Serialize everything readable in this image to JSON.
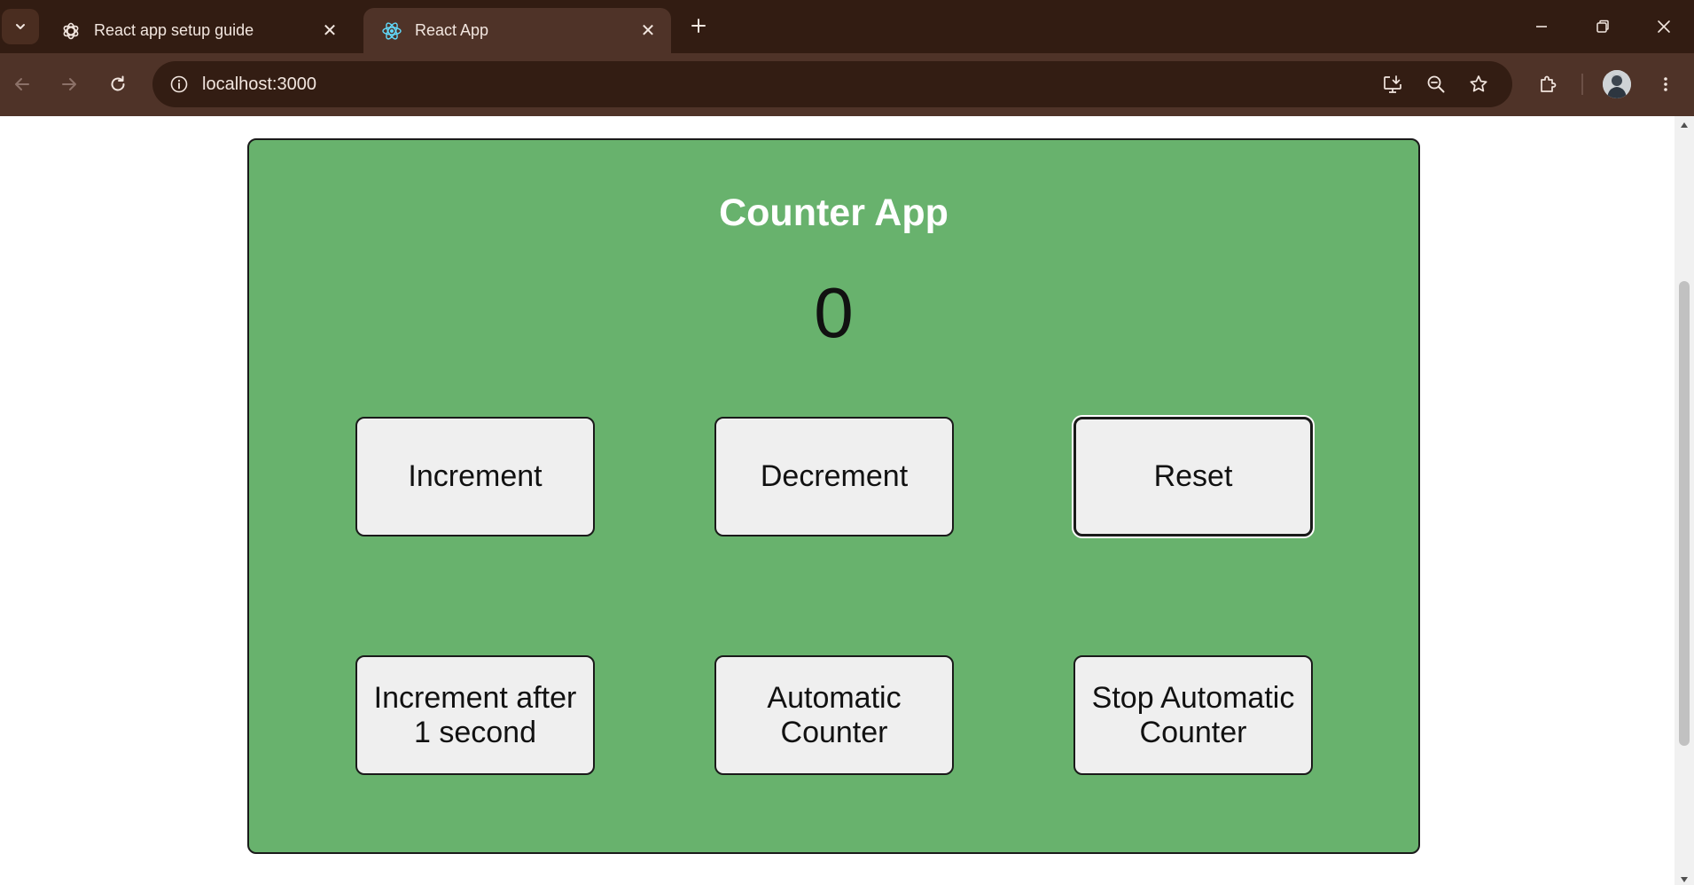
{
  "browser": {
    "tabs": [
      {
        "label": "React app setup guide",
        "icon": "openai-logo-icon",
        "active": false
      },
      {
        "label": "React App",
        "icon": "react-logo-icon",
        "active": true
      }
    ],
    "close_symbol": "✕",
    "address": "localhost:3000",
    "colors": {
      "frame": "#321c12",
      "toolbar": "#4f3328",
      "omnibox": "#331d13"
    }
  },
  "app": {
    "title": "Counter App",
    "count": "0",
    "buttons": {
      "increment": "Increment",
      "decrement": "Decrement",
      "reset": "Reset",
      "increment_delay_line1": "Increment after",
      "increment_delay_line2": "1 second",
      "auto_line1": "Automatic",
      "auto_line2": "Counter",
      "stop_line1": "Stop Automatic",
      "stop_line2": "Counter"
    },
    "colors": {
      "card": "#68b26d",
      "button": "#efefef",
      "title": "#ffffff"
    }
  }
}
